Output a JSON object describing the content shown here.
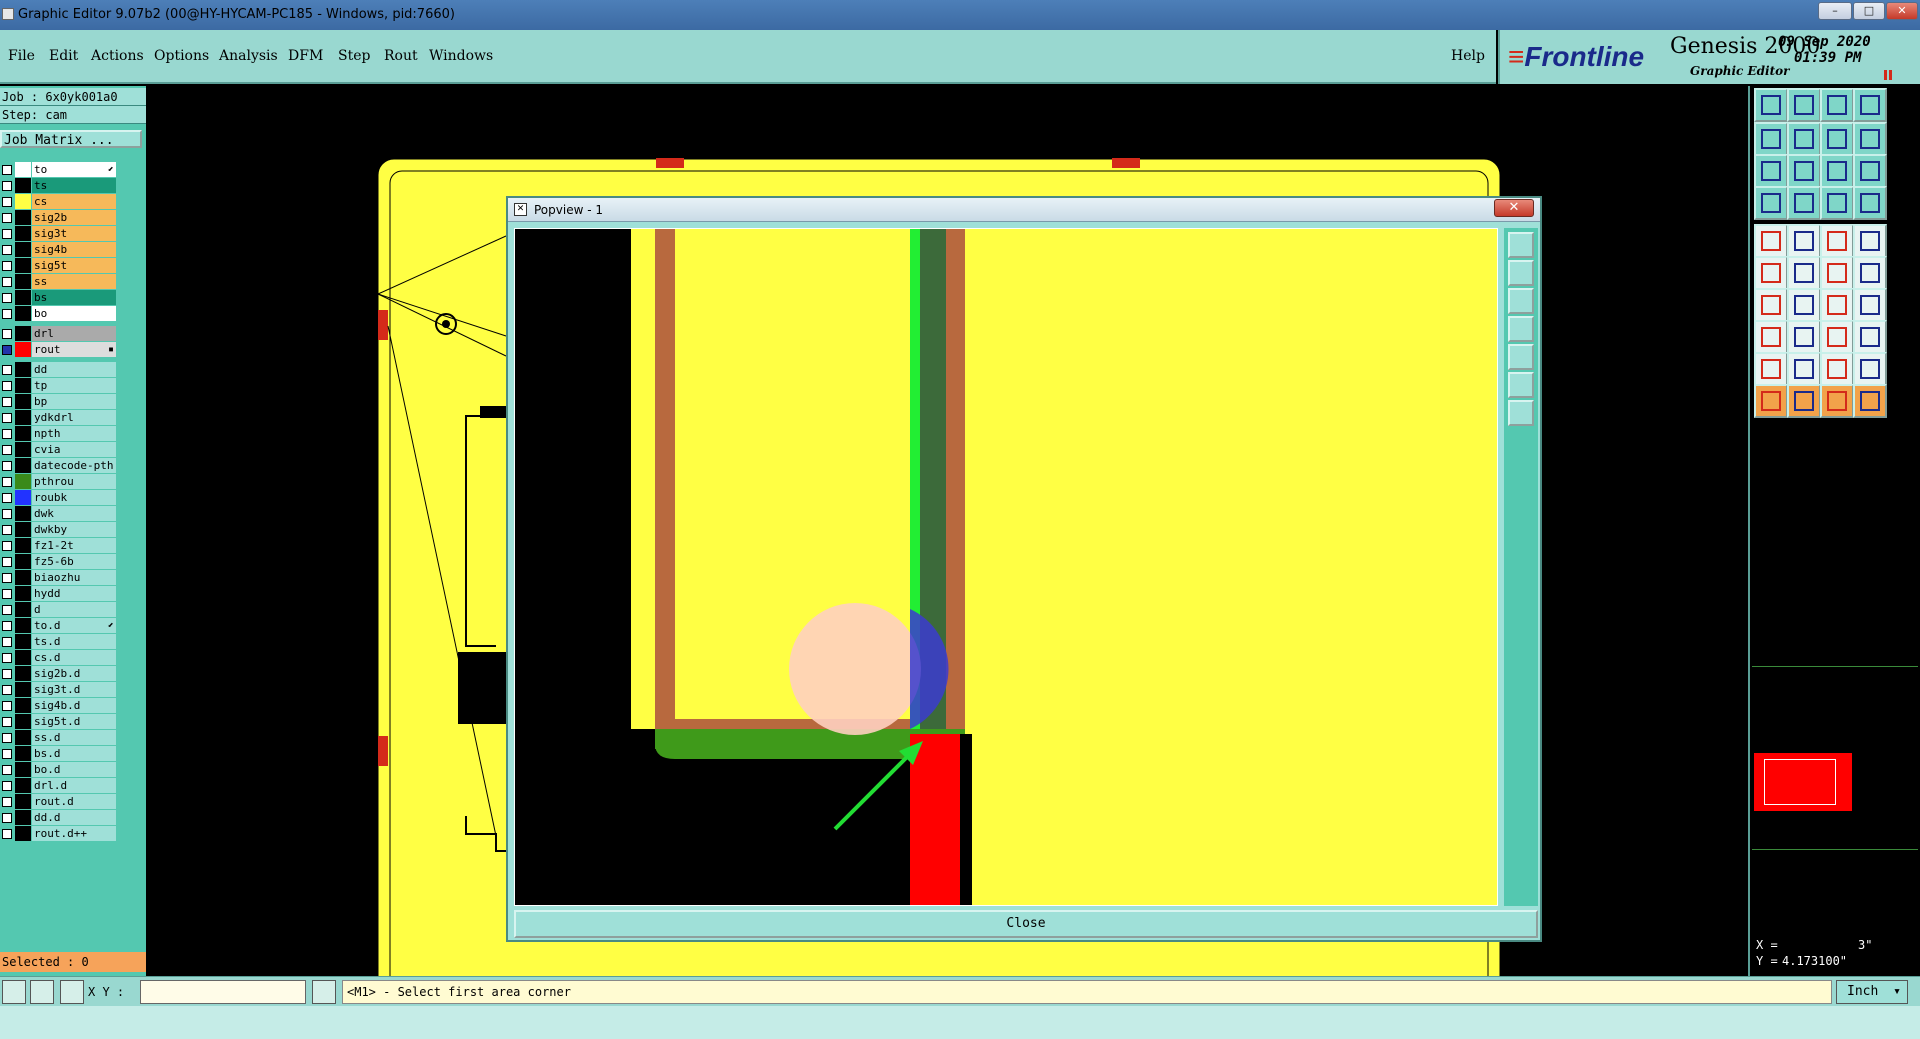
{
  "window": {
    "title": "Graphic Editor 9.07b2 (00@HY-HYCAM-PC185 - Windows, pid:7660)",
    "min_glyph": "–",
    "max_glyph": "□",
    "close_glyph": "✕"
  },
  "menu": {
    "items": [
      "File",
      "Edit",
      "Actions",
      "Options",
      "Analysis",
      "DFM",
      "Step",
      "Rout",
      "Windows"
    ],
    "help": "Help"
  },
  "logo": {
    "brand": "Frontline",
    "product": "Genesis 2000",
    "subtitle": "Graphic Editor",
    "date": "09 Sep 2020",
    "time": "01:39 PM"
  },
  "left": {
    "job": "Job : 6x0yk001a0",
    "step": "Step: cam",
    "matrix_button": "Job Matrix ...",
    "layers": [
      {
        "name": "to",
        "color": "#ffffff",
        "bg": "#ffffff",
        "checked": false,
        "mark": "⬋"
      },
      {
        "name": "ts",
        "color": "#000000",
        "bg": "#1a9a7a",
        "checked": false
      },
      {
        "name": "cs",
        "color": "#ffff44",
        "bg": "#f6b95a",
        "checked": false
      },
      {
        "name": "sig2b",
        "color": "#000000",
        "bg": "#f6b95a",
        "checked": false
      },
      {
        "name": "sig3t",
        "color": "#000000",
        "bg": "#f6b95a",
        "checked": false
      },
      {
        "name": "sig4b",
        "color": "#000000",
        "bg": "#f6b95a",
        "checked": false
      },
      {
        "name": "sig5t",
        "color": "#000000",
        "bg": "#f6b95a",
        "checked": false
      },
      {
        "name": "ss",
        "color": "#000000",
        "bg": "#f6b95a",
        "checked": false
      },
      {
        "name": "bs",
        "color": "#000000",
        "bg": "#1a9a7a",
        "checked": false
      },
      {
        "name": "bo",
        "color": "#000000",
        "bg": "#ffffff",
        "checked": false
      },
      {
        "name": "drl",
        "color": "#000000",
        "bg": "#aaaaaa",
        "checked": false,
        "gap": true
      },
      {
        "name": "rout",
        "color": "#ff0000",
        "bg": "#dddddd",
        "checked": true,
        "mark": "▪"
      },
      {
        "name": "dd",
        "color": "#000000",
        "bg": "#9fe0d8",
        "checked": false,
        "gap": true
      },
      {
        "name": "tp",
        "color": "#000000",
        "bg": "#9fe0d8",
        "checked": false
      },
      {
        "name": "bp",
        "color": "#000000",
        "bg": "#9fe0d8",
        "checked": false
      },
      {
        "name": "ydkdrl",
        "color": "#000000",
        "bg": "#9fe0d8",
        "checked": false
      },
      {
        "name": "npth",
        "color": "#000000",
        "bg": "#9fe0d8",
        "checked": false
      },
      {
        "name": "cvia",
        "color": "#000000",
        "bg": "#9fe0d8",
        "checked": false
      },
      {
        "name": "datecode-pth",
        "color": "#000000",
        "bg": "#9fe0d8",
        "checked": false
      },
      {
        "name": "pthrou",
        "color": "#3a8a1a",
        "bg": "#9fe0d8",
        "checked": false
      },
      {
        "name": "roubk",
        "color": "#2233ff",
        "bg": "#9fe0d8",
        "checked": false
      },
      {
        "name": "dwk",
        "color": "#000000",
        "bg": "#9fe0d8",
        "checked": false
      },
      {
        "name": "dwkby",
        "color": "#000000",
        "bg": "#9fe0d8",
        "checked": false
      },
      {
        "name": "fz1-2t",
        "color": "#000000",
        "bg": "#9fe0d8",
        "checked": false
      },
      {
        "name": "fz5-6b",
        "color": "#000000",
        "bg": "#9fe0d8",
        "checked": false
      },
      {
        "name": "biaozhu",
        "color": "#000000",
        "bg": "#9fe0d8",
        "checked": false
      },
      {
        "name": "hydd",
        "color": "#000000",
        "bg": "#9fe0d8",
        "checked": false
      },
      {
        "name": "d",
        "color": "#000000",
        "bg": "#9fe0d8",
        "checked": false
      },
      {
        "name": "to.d",
        "color": "#000000",
        "bg": "#9fe0d8",
        "checked": false,
        "mark": "⬋"
      },
      {
        "name": "ts.d",
        "color": "#000000",
        "bg": "#9fe0d8",
        "checked": false
      },
      {
        "name": "cs.d",
        "color": "#000000",
        "bg": "#9fe0d8",
        "checked": false
      },
      {
        "name": "sig2b.d",
        "color": "#000000",
        "bg": "#9fe0d8",
        "checked": false
      },
      {
        "name": "sig3t.d",
        "color": "#000000",
        "bg": "#9fe0d8",
        "checked": false
      },
      {
        "name": "sig4b.d",
        "color": "#000000",
        "bg": "#9fe0d8",
        "checked": false
      },
      {
        "name": "sig5t.d",
        "color": "#000000",
        "bg": "#9fe0d8",
        "checked": false
      },
      {
        "name": "ss.d",
        "color": "#000000",
        "bg": "#9fe0d8",
        "checked": false
      },
      {
        "name": "bs.d",
        "color": "#000000",
        "bg": "#9fe0d8",
        "checked": false
      },
      {
        "name": "bo.d",
        "color": "#000000",
        "bg": "#9fe0d8",
        "checked": false
      },
      {
        "name": "drl.d",
        "color": "#000000",
        "bg": "#9fe0d8",
        "checked": false
      },
      {
        "name": "rout.d",
        "color": "#000000",
        "bg": "#9fe0d8",
        "checked": false
      },
      {
        "name": "dd.d",
        "color": "#000000",
        "bg": "#9fe0d8",
        "checked": false
      },
      {
        "name": "rout.d++",
        "color": "#000000",
        "bg": "#9fe0d8",
        "checked": false
      }
    ],
    "selected": "Selected : 0"
  },
  "bottom": {
    "xy_label": "X Y :",
    "xy_value": "",
    "prompt": "<M1> - Select first area corner",
    "unit": "Inch"
  },
  "coords": {
    "x_label": "X =",
    "x_value": "3\"",
    "y_label": "Y =",
    "y_value": "4.173100\""
  },
  "popup": {
    "title": "Popview - 1",
    "close": "Close"
  },
  "colors": {
    "teal": "#99d8d0",
    "board": "#ffff44",
    "copper": "#b8693e",
    "green": "#3f9a1a",
    "rout_red": "#ff0000",
    "arrow_green": "#22dd33"
  }
}
